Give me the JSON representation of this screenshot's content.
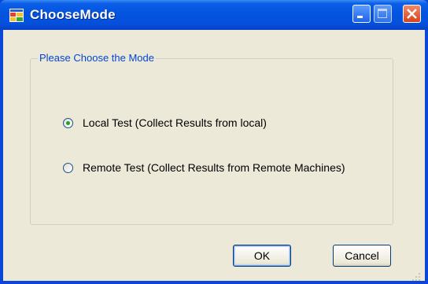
{
  "window": {
    "title": "ChooseMode",
    "controls": {
      "minimize": "minimize",
      "maximize": "maximize",
      "close": "close"
    }
  },
  "group": {
    "label": "Please Choose the Mode"
  },
  "options": [
    {
      "label": "Local Test (Collect Results from local)",
      "selected": true
    },
    {
      "label": "Remote Test (Collect Results from Remote Machines)",
      "selected": false
    }
  ],
  "buttons": {
    "ok": "OK",
    "cancel": "Cancel"
  },
  "colors": {
    "titlebar": "#0454e0",
    "client": "#ece9d8",
    "group_label": "#0046d5",
    "radio_dot": "#21a121",
    "close_button": "#d8421b"
  },
  "icons": {
    "app": "window-app-icon",
    "minimize": "minimize-icon",
    "maximize": "maximize-icon",
    "close": "close-icon"
  }
}
